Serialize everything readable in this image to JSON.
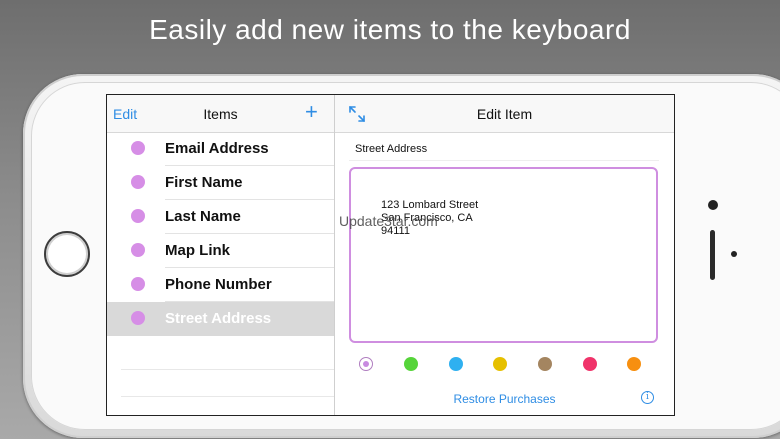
{
  "headline": "Easily add new items to the keyboard",
  "items_panel": {
    "edit_label": "Edit",
    "title": "Items",
    "add_glyph": "+",
    "items": [
      {
        "label": "Email Address",
        "selected": false
      },
      {
        "label": "First Name",
        "selected": false
      },
      {
        "label": "Last Name",
        "selected": false
      },
      {
        "label": "Map Link",
        "selected": false
      },
      {
        "label": "Phone Number",
        "selected": false
      },
      {
        "label": "Street Address",
        "selected": true
      }
    ]
  },
  "edit_panel": {
    "title": "Edit Item",
    "expand_icon": "expand-arrows-icon",
    "name_value": "Street Address",
    "content_value": "123 Lombard Street\nSan Francisco, CA\n94111",
    "watermark": "Update3tar.com",
    "colors": [
      "#c88ae0",
      "#56d43a",
      "#2fb0f0",
      "#e6c000",
      "#a48560",
      "#f0336a",
      "#f78f10"
    ],
    "selected_color_index": 0,
    "restore_label": "Restore Purchases",
    "info_glyph": "i"
  },
  "accent_color": "#2f8de4",
  "item_dot_color": "#d68ee6"
}
